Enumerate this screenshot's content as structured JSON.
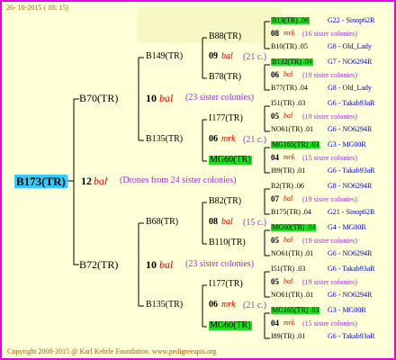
{
  "header": {
    "date": "26- 10-2015 ( 18: 15)"
  },
  "footer": {
    "copyright": "Copyright 2008-2015 @ Karl Kehrle Foundation.   www.pedigreeapis.org"
  },
  "root": {
    "id": "B173(TR)",
    "num": "12",
    "mark": "bal",
    "note": "(Drones from 24 sister colonies)"
  },
  "g1": {
    "top": {
      "id": "B70(TR)",
      "num": "10",
      "mark": "bal",
      "note": "(23 sister colonies)"
    },
    "bottom": {
      "id": "B72(TR)",
      "num": "10",
      "mark": "bal",
      "note": "(23 sister colonies)"
    }
  },
  "g2": {
    "a": {
      "id": "B149(TR)",
      "num": "09",
      "mark": "bal",
      "note": "(21 c.)"
    },
    "b": {
      "id": "B135(TR)",
      "num": "06",
      "mark": "mrk",
      "note": "(21 c.)"
    },
    "c": {
      "id": "B68(TR)",
      "num": "08",
      "mark": "bal",
      "note": "(15 c.)"
    },
    "d": {
      "id": "B135(TR)",
      "num": "06",
      "mark": "mrk",
      "note": "(21 c.)"
    }
  },
  "g3": {
    "a1": "B88(TR)",
    "a2": "B78(TR)",
    "b1": "I177(TR)",
    "b2": "MG60(TR)",
    "c1": "B82(TR)",
    "c2": "B110(TR)",
    "d1": "I177(TR)",
    "d2": "MG60(TR)"
  },
  "g4": [
    {
      "top": "B13(TR) .06",
      "top_code": "G22 - Sinop62R",
      "top_green": true,
      "num": "08",
      "mark": "mrk",
      "note": "(16 sister colonies)",
      "bot": "B10(TR) .05",
      "bot_code": "G8 - Old_Lady"
    },
    {
      "top": "B132(TR) .04",
      "top_code": "G7 - NO6294R",
      "top_green": true,
      "num": "06",
      "mark": "bal",
      "note": "(19 sister colonies)",
      "bot": "B77(TR) .04",
      "bot_code": "G8 - Old_Lady"
    },
    {
      "top": "I51(TR) .03",
      "top_code": "G6 - Takab93aR",
      "top_green": false,
      "num": "05",
      "mark": "bal",
      "note": "(19 sister colonies)",
      "bot": "NO61(TR) .01",
      "bot_code": "G6 - NO6294R"
    },
    {
      "top": "MG165(TR) .03",
      "top_code": "G3 - MG00R",
      "top_green": true,
      "num": "04",
      "mark": "mrk",
      "note": "(15 sister colonies)",
      "bot": "I89(TR) .01",
      "bot_code": "G6 - Takab93aR"
    },
    {
      "top": "B2(TR) .06",
      "top_code": "G8 - NO6294R",
      "top_green": false,
      "num": "07",
      "mark": "bal",
      "note": "(19 sister colonies)",
      "bot": "B175(TR) .04",
      "bot_code": "G21 - Sinop62R"
    },
    {
      "top": "MG60(TR) .04",
      "top_code": "G4 - MG00R",
      "top_green": true,
      "num": "05",
      "mark": "bal",
      "note": "(19 sister colonies)",
      "bot": "NO61(TR) .01",
      "bot_code": "G6 - NO6294R"
    },
    {
      "top": "I51(TR) .03",
      "top_code": "G6 - Takab93aR",
      "top_green": false,
      "num": "05",
      "mark": "bal",
      "note": "(19 sister colonies)",
      "bot": "NO61(TR) .01",
      "bot_code": "G6 - NO6294R"
    },
    {
      "top": "MG165(TR) .03",
      "top_code": "G3 - MG00R",
      "top_green": true,
      "num": "04",
      "mark": "mrk",
      "note": "(15 sister colonies)",
      "bot": "I89(TR) .01",
      "bot_code": "G6 - Takab93aR"
    }
  ]
}
